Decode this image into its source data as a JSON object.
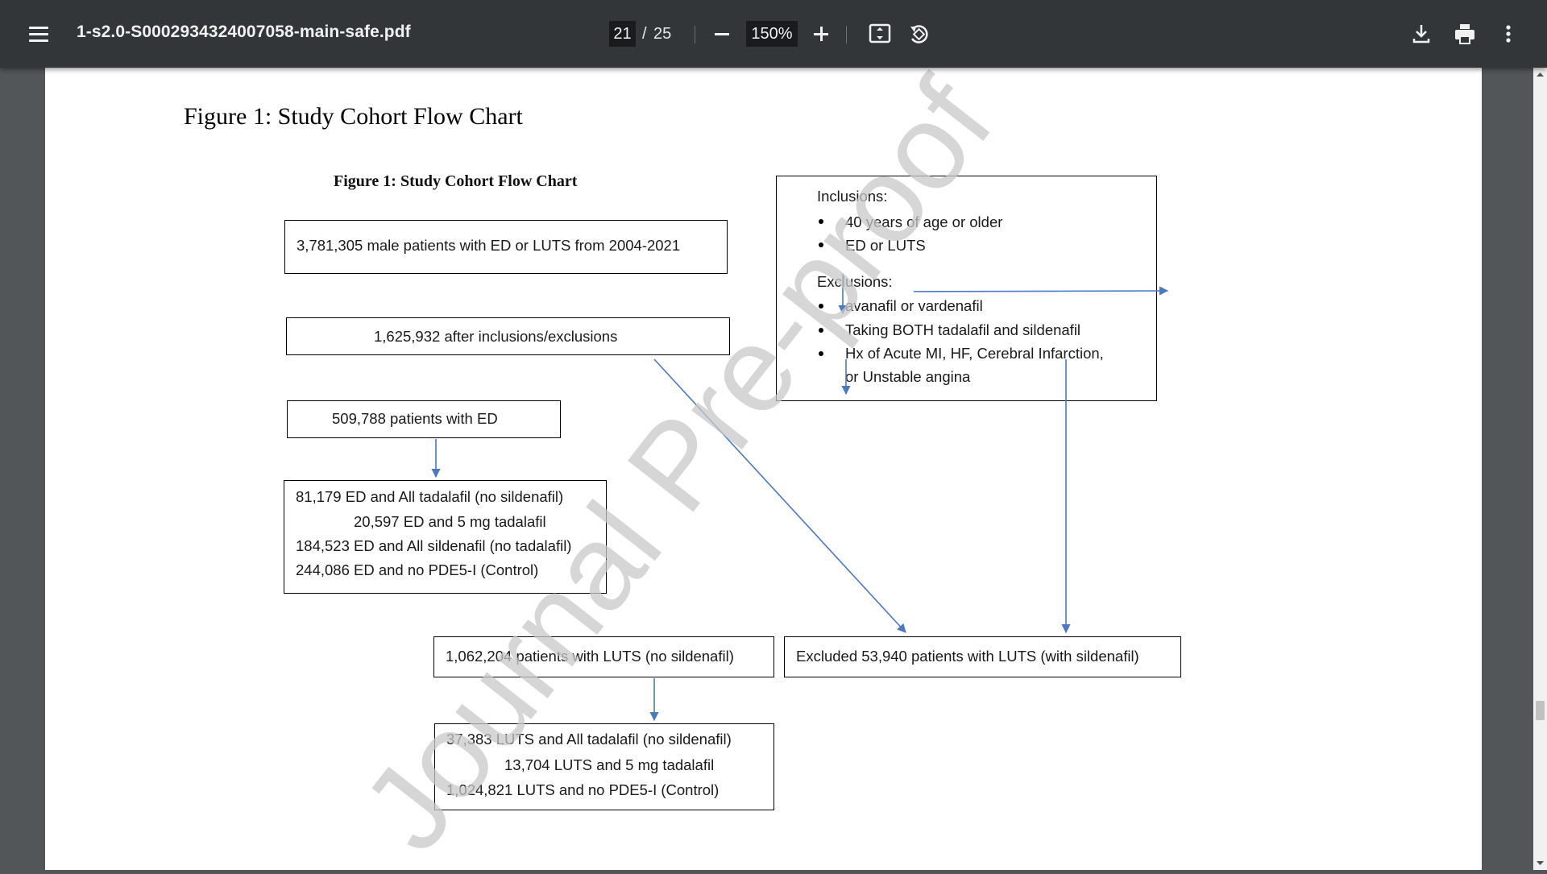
{
  "toolbar": {
    "file_name": "1-s2.0-S0002934324007058-main-safe.pdf",
    "current_page": "21",
    "page_separator": "/",
    "total_pages": "25",
    "zoom": "150%"
  },
  "document": {
    "figure_heading": "Figure 1: Study Cohort Flow Chart",
    "figure_subheading": "Figure 1: Study Cohort Flow Chart",
    "watermark": "Journal Pre-proof",
    "boxes": {
      "total": "3,781,305  male patients with ED or LUTS from 2004-2021",
      "after_filter": "1,625,932  after inclusions/exclusions",
      "ed": "509,788  patients with ED",
      "ed_breakdown": [
        "81,179  ED and All tadalafil (no sildenafil)",
        "20,597  ED and 5 mg tadalafil",
        "184,523  ED and All sildenafil (no tadalafil)",
        "244,086  ED and no PDE5-I (Control)"
      ],
      "luts": "1,062,204  patients with LUTS (no sildenafil)",
      "excluded": "Excluded 53,940  patients with LUTS (with sildenafil)",
      "luts_breakdown": [
        "37,383  LUTS and All tadalafil (no sildenafil)",
        "13,704  LUTS and 5 mg tadalafil",
        "1,024,821  LUTS and no PDE5-I (Control)"
      ],
      "criteria": {
        "inclusions_title": "Inclusions:",
        "inclusions": [
          "40 years of age or older",
          "ED or LUTS"
        ],
        "exclusions_title": "Exclusions:",
        "exclusions": [
          "avanafil or vardenafil",
          "Taking BOTH tadalafil and sildenafil",
          "Hx of Acute MI, HF, Cerebral Infarction,",
          "or Unstable angina"
        ]
      }
    }
  },
  "colors": {
    "toolbar_bg": "#323639",
    "viewer_bg": "#525659",
    "arrow": "#4a78c2",
    "watermark": "#c8c8c8"
  }
}
